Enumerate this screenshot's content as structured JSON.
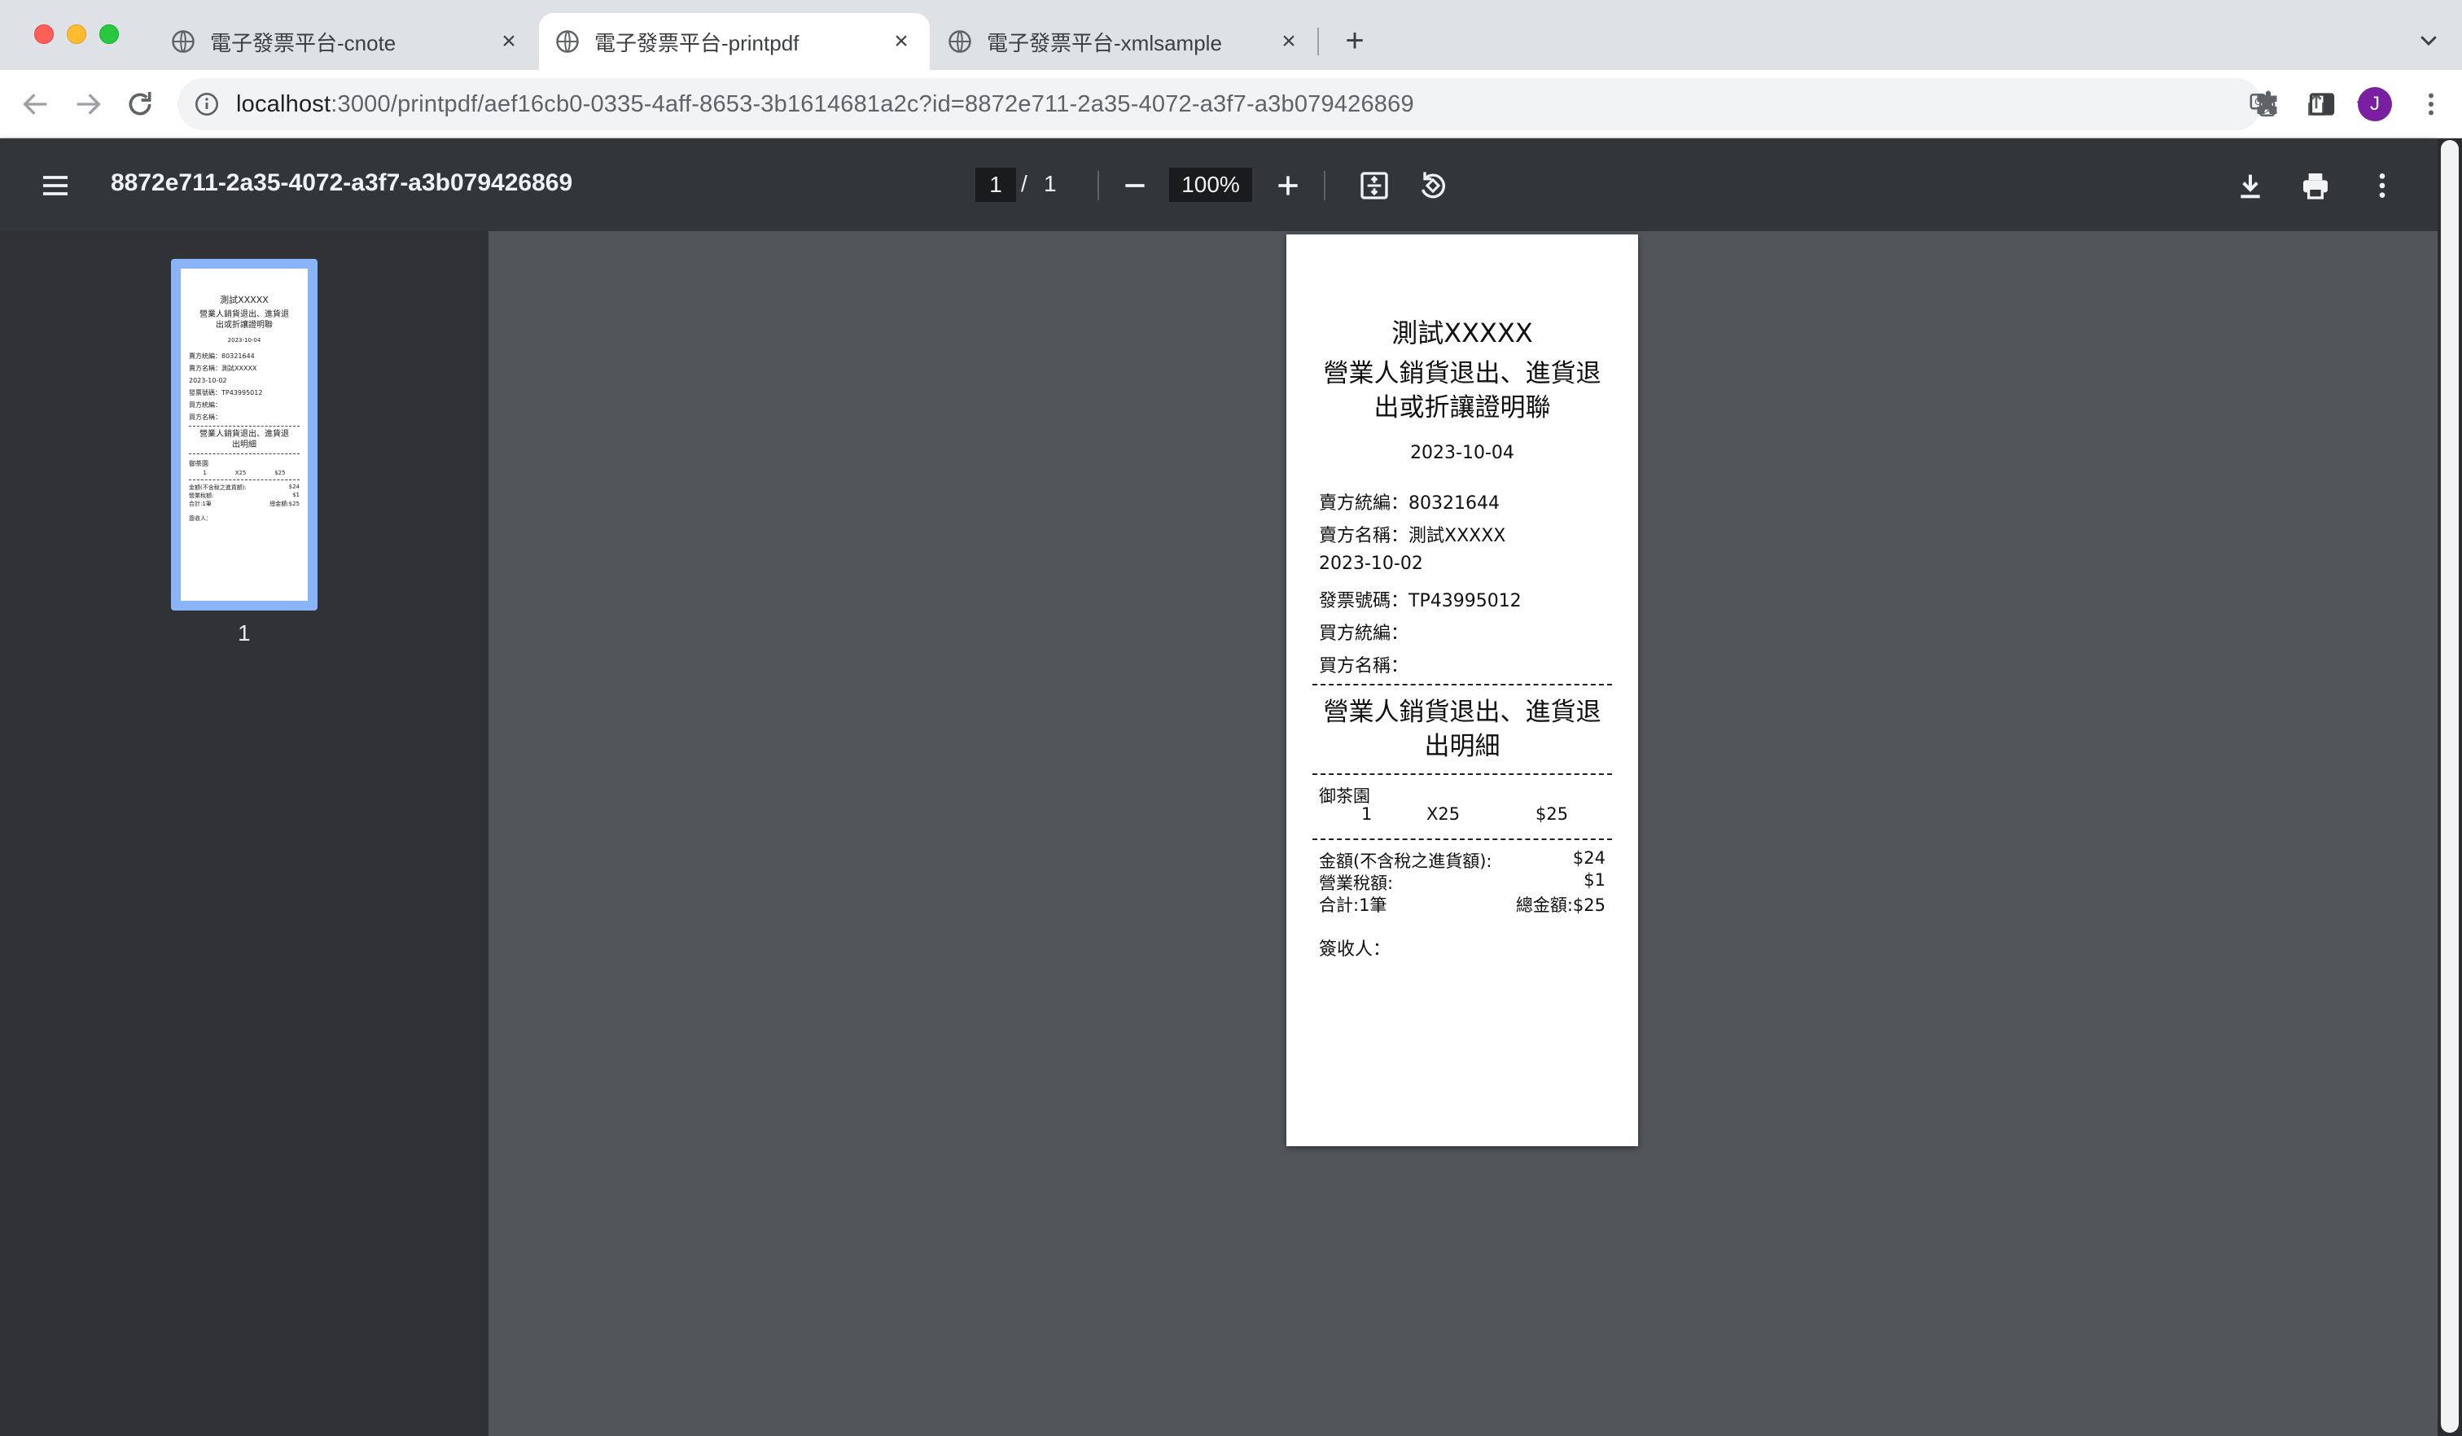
{
  "browser": {
    "tabs": [
      {
        "title": "電子發票平台-cnote",
        "active": false
      },
      {
        "title": "電子發票平台-printpdf",
        "active": true
      },
      {
        "title": "電子發票平台-xmlsample",
        "active": false
      }
    ],
    "url_host": "localhost",
    "url_rest": ":3000/printpdf/aef16cb0-0335-4aff-8653-3b1614681a2c?id=8872e711-2a35-4072-a3f7-a3b079426869",
    "avatar_letter": "J",
    "avatar_color": "#7b1fa2"
  },
  "pdf_viewer": {
    "title": "8872e711-2a35-4072-a3f7-a3b079426869",
    "current_page": "1",
    "page_separator": "/",
    "total_pages": "1",
    "zoom": "100%",
    "thumbnail_label": "1"
  },
  "document": {
    "store_name": "測試XXXXX",
    "doc_title_line1": "營業人銷貨退出、進貨退",
    "doc_title_line2": "出或折讓證明聯",
    "date": "2023-10-04",
    "seller_id": "賣方統編：80321644",
    "seller_name": "賣方名稱：測試XXXXX",
    "invoice_date": "2023-10-02",
    "invoice_number": "發票號碼：TP43995012",
    "buyer_id": "買方統編：",
    "buyer_name": "買方名稱：",
    "detail_title_line1": "營業人銷貨退出、進貨退",
    "detail_title_line2": "出明細",
    "item_name": "御茶園",
    "item_qty": "1",
    "item_unit": "X25",
    "item_amount": "$25",
    "amount_label": "金額(不含稅之進貨額):",
    "amount_value": "$24",
    "tax_label": "營業稅額:",
    "tax_value": "$1",
    "count_label": "合計:1筆",
    "total_label": "總金額:$25",
    "signer_label": "簽收人："
  }
}
